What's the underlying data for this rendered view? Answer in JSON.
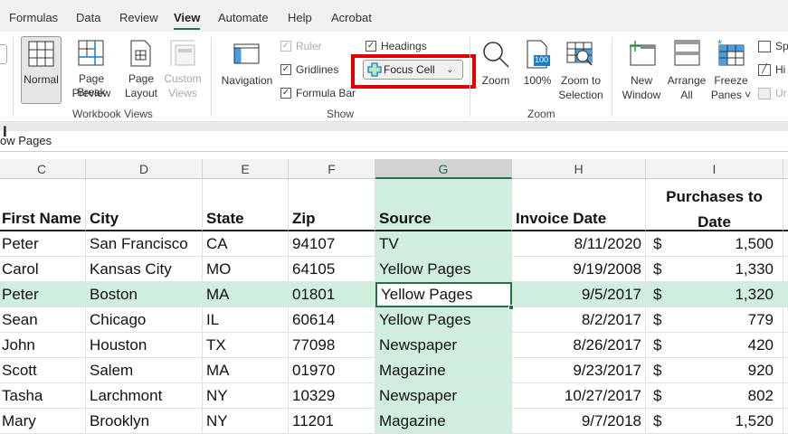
{
  "tabs": [
    "Formulas",
    "Data",
    "Review",
    "View",
    "Automate",
    "Help",
    "Acrobat"
  ],
  "active_tab": "View",
  "ribbon": {
    "workbook_views": {
      "normal": "Normal",
      "page_break_1": "Page Break",
      "page_break_2": "Preview",
      "page_layout_1": "Page",
      "page_layout_2": "Layout",
      "custom_1": "Custom",
      "custom_2": "Views",
      "group": "Workbook Views"
    },
    "show": {
      "navigation": "Navigation",
      "ruler": "Ruler",
      "gridlines": "Gridlines",
      "formula_bar": "Formula Bar",
      "headings": "Headings",
      "focus_cell": "Focus Cell",
      "group": "Show",
      "ruler_checked": true,
      "gridlines_checked": true,
      "formula_bar_checked": true,
      "headings_checked": true
    },
    "zoom": {
      "zoom": "Zoom",
      "hundred": "100%",
      "icon_100": "100",
      "zts_1": "Zoom to",
      "zts_2": "Selection",
      "group": "Zoom"
    },
    "window": {
      "new_1": "New",
      "new_2": "Window",
      "arrange_1": "Arrange",
      "arrange_2": "All",
      "freeze_1": "Freeze",
      "freeze_2": "Panes",
      "split": "Sp",
      "hide": "Hi",
      "unhide": "Ur"
    }
  },
  "highlight_color": "#e00000",
  "formula_bar": {
    "value": "ow Pages"
  },
  "columns": [
    "C",
    "D",
    "E",
    "F",
    "G",
    "H",
    "I"
  ],
  "selected_column": "G",
  "headers": [
    "First Name",
    "City",
    "State",
    "Zip",
    "Source",
    "Invoice Date",
    "Purchases to",
    "Date"
  ],
  "rows": [
    {
      "first": "Peter",
      "city": "San Francisco",
      "state": "CA",
      "zip": "94107",
      "source": "TV",
      "date": "8/11/2020",
      "cur": "$",
      "amt": "1,500"
    },
    {
      "first": "Carol",
      "city": "Kansas City",
      "state": "MO",
      "zip": "64105",
      "source": "Yellow Pages",
      "date": "9/19/2008",
      "cur": "$",
      "amt": "1,330"
    },
    {
      "first": "Peter",
      "city": "Boston",
      "state": "MA",
      "zip": "01801",
      "source": "Yellow Pages",
      "date": "9/5/2017",
      "cur": "$",
      "amt": "1,320"
    },
    {
      "first": "Sean",
      "city": "Chicago",
      "state": "IL",
      "zip": "60614",
      "source": "Yellow Pages",
      "date": "8/2/2017",
      "cur": "$",
      "amt": "779"
    },
    {
      "first": "John",
      "city": "Houston",
      "state": "TX",
      "zip": "77098",
      "source": "Newspaper",
      "date": "8/26/2017",
      "cur": "$",
      "amt": "420"
    },
    {
      "first": "Scott",
      "city": "Salem",
      "state": "MA",
      "zip": "01970",
      "source": "Magazine",
      "date": "9/23/2017",
      "cur": "$",
      "amt": "920"
    },
    {
      "first": "Tasha",
      "city": "Larchmont",
      "state": "NY",
      "zip": "10329",
      "source": "Newspaper",
      "date": "10/27/2017",
      "cur": "$",
      "amt": "802"
    },
    {
      "first": "Mary",
      "city": "Brooklyn",
      "state": "NY",
      "zip": "11201",
      "source": "Magazine",
      "date": "9/7/2018",
      "cur": "$",
      "amt": "1,520"
    }
  ],
  "active_row": 2
}
